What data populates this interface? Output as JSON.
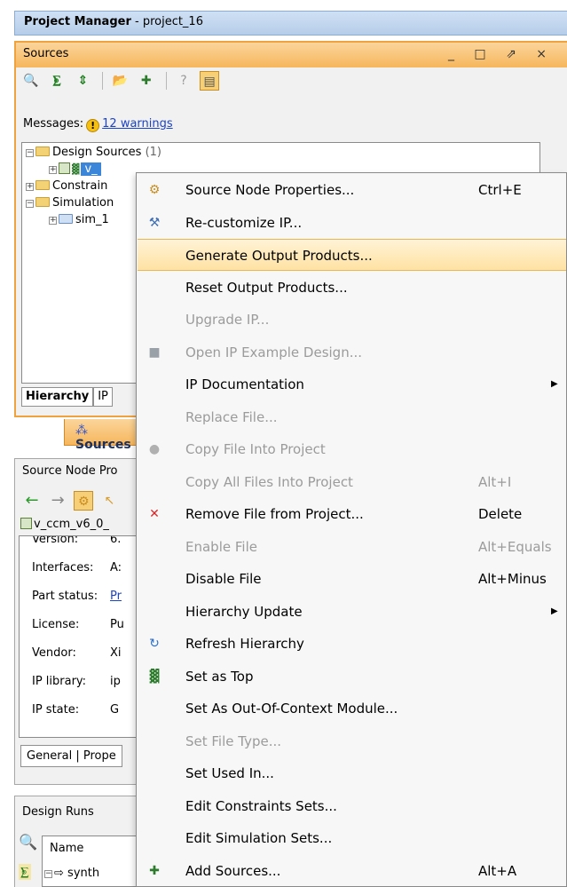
{
  "title_bar": {
    "bold": "Project Manager",
    "project": " - project_16"
  },
  "sources": {
    "title": "Sources",
    "window_controls": "_ □ ⇗ ×",
    "messages_label": "Messages:",
    "warnings_link": "12 warnings",
    "tree": {
      "design_sources": "Design Sources",
      "design_sources_count": " (1)",
      "selected_item": "v_",
      "constraints": "Constrain",
      "simulation": "Simulation",
      "sim_item": "sim_1"
    },
    "tabs": [
      "Hierarchy",
      "IP"
    ],
    "bottom_tab": "Sources"
  },
  "properties": {
    "header": "Source Node Pro",
    "item_name": "v_ccm_v6_0_",
    "rows": [
      {
        "key": "Version:",
        "value": "6."
      },
      {
        "key": "Interfaces:",
        "value": "A:"
      },
      {
        "key": "Part status:",
        "value": "Pr"
      },
      {
        "key": "License:",
        "value": "Pu"
      },
      {
        "key": "Vendor:",
        "value": "Xi"
      },
      {
        "key": "IP library:",
        "value": "ip"
      },
      {
        "key": "IP state:",
        "value": "G"
      }
    ],
    "tabs": [
      "General",
      "Prope"
    ]
  },
  "design_runs": {
    "header": "Design Runs",
    "column": "Name",
    "row": "synth"
  },
  "context_menu": {
    "items": [
      {
        "icon": "properties-icon",
        "label": "Source Node Properties...",
        "shortcut": "Ctrl+E",
        "disabled": false
      },
      {
        "icon": "recustomize-icon",
        "label": "Re-customize IP...",
        "shortcut": "",
        "disabled": false
      },
      {
        "icon": "",
        "label": "Generate Output Products...",
        "shortcut": "",
        "disabled": false,
        "highlighted": true
      },
      {
        "icon": "",
        "label": "Reset Output Products...",
        "shortcut": "",
        "disabled": false
      },
      {
        "icon": "",
        "label": "Upgrade IP...",
        "shortcut": "",
        "disabled": true
      },
      {
        "icon": "example-design-icon",
        "label": "Open IP Example Design...",
        "shortcut": "",
        "disabled": true
      },
      {
        "icon": "",
        "label": "IP Documentation",
        "shortcut": "",
        "disabled": false,
        "submenu": true
      },
      {
        "icon": "",
        "label": "Replace File...",
        "shortcut": "",
        "disabled": true
      },
      {
        "icon": "copy-file-icon",
        "label": "Copy File Into Project",
        "shortcut": "",
        "disabled": true
      },
      {
        "icon": "",
        "label": "Copy All Files Into Project",
        "shortcut": "Alt+I",
        "disabled": true
      },
      {
        "icon": "remove-icon",
        "label": "Remove File from Project...",
        "shortcut": "Delete",
        "disabled": false
      },
      {
        "icon": "",
        "label": "Enable File",
        "shortcut": "Alt+Equals",
        "disabled": true
      },
      {
        "icon": "",
        "label": "Disable File",
        "shortcut": "Alt+Minus",
        "disabled": false
      },
      {
        "icon": "",
        "label": "Hierarchy Update",
        "shortcut": "",
        "disabled": false,
        "submenu": true
      },
      {
        "icon": "refresh-icon",
        "label": "Refresh Hierarchy",
        "shortcut": "",
        "disabled": false
      },
      {
        "icon": "set-top-icon",
        "label": "Set as Top",
        "shortcut": "",
        "disabled": false
      },
      {
        "icon": "",
        "label": "Set As Out-Of-Context Module...",
        "shortcut": "",
        "disabled": false
      },
      {
        "icon": "",
        "label": "Set File Type...",
        "shortcut": "",
        "disabled": true
      },
      {
        "icon": "",
        "label": "Set Used In...",
        "shortcut": "",
        "disabled": false
      },
      {
        "icon": "",
        "label": "Edit Constraints Sets...",
        "shortcut": "",
        "disabled": false
      },
      {
        "icon": "",
        "label": "Edit Simulation Sets...",
        "shortcut": "",
        "disabled": false
      },
      {
        "icon": "add-sources-icon",
        "label": "Add Sources...",
        "shortcut": "Alt+A",
        "disabled": false
      }
    ]
  },
  "colors": {
    "accent_orange": "#f6b65c",
    "selection_blue": "#3b86d8",
    "highlight": "#ffe2a3",
    "link": "#1b43c7",
    "remove_red": "#d42a2a"
  }
}
